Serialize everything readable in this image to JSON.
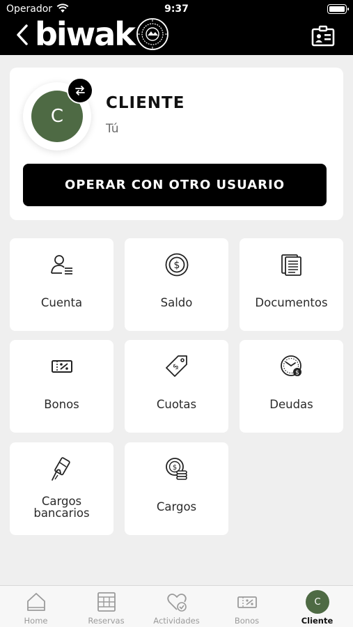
{
  "status_bar": {
    "carrier": "Operador",
    "time": "9:37"
  },
  "header": {
    "brand": "biwak",
    "seal_icon": "club-seal-icon",
    "back_icon": "chevron-left-icon",
    "id_icon": "id-card-icon"
  },
  "profile": {
    "avatar_initial": "C",
    "name": "CLIENTE",
    "role": "Tú",
    "swap_icon": "swap-arrows-icon",
    "operate_button": "OPERAR CON OTRO USUARIO"
  },
  "tiles": [
    {
      "label": "Cuenta",
      "icon": "user-list-icon"
    },
    {
      "label": "Saldo",
      "icon": "coin-dollar-icon"
    },
    {
      "label": "Documentos",
      "icon": "documents-icon"
    },
    {
      "label": "Bonos",
      "icon": "ticket-percent-icon"
    },
    {
      "label": "Cuotas",
      "icon": "tag-dollar-icon"
    },
    {
      "label": "Deudas",
      "icon": "clock-coin-icon"
    },
    {
      "label": "Cargos bancarios",
      "label_line1": "Cargos",
      "label_line2": "bancarios",
      "icon": "card-hand-icon"
    },
    {
      "label": "Cargos",
      "icon": "coins-stack-icon"
    }
  ],
  "tabbar": [
    {
      "label": "Home",
      "icon": "home-icon"
    },
    {
      "label": "Reservas",
      "icon": "calendar-grid-icon"
    },
    {
      "label": "Actividades",
      "icon": "heart-check-icon"
    },
    {
      "label": "Bonos",
      "icon": "ticket-percent-icon"
    },
    {
      "label": "Cliente",
      "avatar_initial": "C",
      "active": true
    }
  ],
  "colors": {
    "header_bg": "#000000",
    "avatar_bg": "#4e6a44",
    "page_bg": "#efefef"
  }
}
